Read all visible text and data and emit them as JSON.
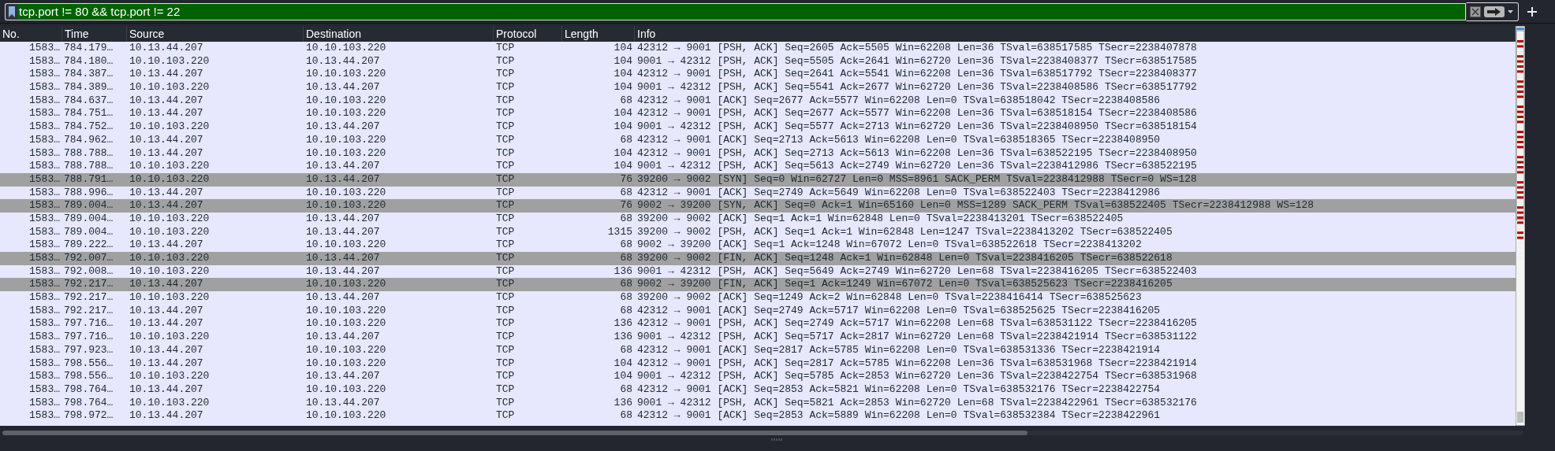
{
  "filter": {
    "value": "tcp.port != 80 && tcp.port != 22"
  },
  "columns": [
    "No.",
    "Time",
    "Source",
    "Destination",
    "Protocol",
    "Length",
    "Info"
  ],
  "rows": [
    {
      "no": "1583…",
      "time": "784.179…",
      "source": "10.13.44.207",
      "destination": "10.10.103.220",
      "protocol": "TCP",
      "length": "104",
      "info": "42312 → 9001 [PSH, ACK] Seq=2605 Ack=5505 Win=62208 Len=36 TSval=638517585 TSecr=2238407878",
      "color": "#e7e7fd"
    },
    {
      "no": "1583…",
      "time": "784.180…",
      "source": "10.10.103.220",
      "destination": "10.13.44.207",
      "protocol": "TCP",
      "length": "104",
      "info": "9001 → 42312 [PSH, ACK] Seq=5505 Ack=2641 Win=62720 Len=36 TSval=2238408377 TSecr=638517585",
      "color": "#e7e7fd"
    },
    {
      "no": "1583…",
      "time": "784.387…",
      "source": "10.13.44.207",
      "destination": "10.10.103.220",
      "protocol": "TCP",
      "length": "104",
      "info": "42312 → 9001 [PSH, ACK] Seq=2641 Ack=5541 Win=62208 Len=36 TSval=638517792 TSecr=2238408377",
      "color": "#e7e7fd"
    },
    {
      "no": "1583…",
      "time": "784.389…",
      "source": "10.10.103.220",
      "destination": "10.13.44.207",
      "protocol": "TCP",
      "length": "104",
      "info": "9001 → 42312 [PSH, ACK] Seq=5541 Ack=2677 Win=62720 Len=36 TSval=2238408586 TSecr=638517792",
      "color": "#e7e7fd"
    },
    {
      "no": "1583…",
      "time": "784.637…",
      "source": "10.13.44.207",
      "destination": "10.10.103.220",
      "protocol": "TCP",
      "length": "68",
      "info": "42312 → 9001 [ACK] Seq=2677 Ack=5577 Win=62208 Len=0 TSval=638518042 TSecr=2238408586",
      "color": "#e7e7fd"
    },
    {
      "no": "1583…",
      "time": "784.751…",
      "source": "10.13.44.207",
      "destination": "10.10.103.220",
      "protocol": "TCP",
      "length": "104",
      "info": "42312 → 9001 [PSH, ACK] Seq=2677 Ack=5577 Win=62208 Len=36 TSval=638518154 TSecr=2238408586",
      "color": "#e7e7fd"
    },
    {
      "no": "1583…",
      "time": "784.752…",
      "source": "10.10.103.220",
      "destination": "10.13.44.207",
      "protocol": "TCP",
      "length": "104",
      "info": "9001 → 42312 [PSH, ACK] Seq=5577 Ack=2713 Win=62720 Len=36 TSval=2238408950 TSecr=638518154",
      "color": "#e7e7fd"
    },
    {
      "no": "1583…",
      "time": "784.962…",
      "source": "10.13.44.207",
      "destination": "10.10.103.220",
      "protocol": "TCP",
      "length": "68",
      "info": "42312 → 9001 [ACK] Seq=2713 Ack=5613 Win=62208 Len=0 TSval=638518365 TSecr=2238408950",
      "color": "#e7e7fd"
    },
    {
      "no": "1583…",
      "time": "788.788…",
      "source": "10.13.44.207",
      "destination": "10.10.103.220",
      "protocol": "TCP",
      "length": "104",
      "info": "42312 → 9001 [PSH, ACK] Seq=2713 Ack=5613 Win=62208 Len=36 TSval=638522195 TSecr=2238408950",
      "color": "#e7e7fd"
    },
    {
      "no": "1583…",
      "time": "788.788…",
      "source": "10.10.103.220",
      "destination": "10.13.44.207",
      "protocol": "TCP",
      "length": "104",
      "info": "9001 → 42312 [PSH, ACK] Seq=5613 Ack=2749 Win=62720 Len=36 TSval=2238412986 TSecr=638522195",
      "color": "#e7e7fd"
    },
    {
      "no": "1583…",
      "time": "788.791…",
      "source": "10.10.103.220",
      "destination": "10.13.44.207",
      "protocol": "TCP",
      "length": "76",
      "info": "39200 → 9002 [SYN] Seq=0 Win=62727 Len=0 MSS=8961 SACK_PERM TSval=2238412988 TSecr=0 WS=128",
      "color": "#a0a0a0"
    },
    {
      "no": "1583…",
      "time": "788.996…",
      "source": "10.13.44.207",
      "destination": "10.10.103.220",
      "protocol": "TCP",
      "length": "68",
      "info": "42312 → 9001 [ACK] Seq=2749 Ack=5649 Win=62208 Len=0 TSval=638522403 TSecr=2238412986",
      "color": "#e7e7fd"
    },
    {
      "no": "1583…",
      "time": "789.004…",
      "source": "10.13.44.207",
      "destination": "10.10.103.220",
      "protocol": "TCP",
      "length": "76",
      "info": "9002 → 39200 [SYN, ACK] Seq=0 Ack=1 Win=65160 Len=0 MSS=1289 SACK_PERM TSval=638522405 TSecr=2238412988 WS=128",
      "color": "#a0a0a0"
    },
    {
      "no": "1583…",
      "time": "789.004…",
      "source": "10.10.103.220",
      "destination": "10.13.44.207",
      "protocol": "TCP",
      "length": "68",
      "info": "39200 → 9002 [ACK] Seq=1 Ack=1 Win=62848 Len=0 TSval=2238413201 TSecr=638522405",
      "color": "#e7e7fd"
    },
    {
      "no": "1583…",
      "time": "789.004…",
      "source": "10.10.103.220",
      "destination": "10.13.44.207",
      "protocol": "TCP",
      "length": "1315",
      "info": "39200 → 9002 [PSH, ACK] Seq=1 Ack=1 Win=62848 Len=1247 TSval=2238413202 TSecr=638522405",
      "color": "#e7e7fd"
    },
    {
      "no": "1583…",
      "time": "789.222…",
      "source": "10.13.44.207",
      "destination": "10.10.103.220",
      "protocol": "TCP",
      "length": "68",
      "info": "9002 → 39200 [ACK] Seq=1 Ack=1248 Win=67072 Len=0 TSval=638522618 TSecr=2238413202",
      "color": "#e7e7fd"
    },
    {
      "no": "1583…",
      "time": "792.007…",
      "source": "10.10.103.220",
      "destination": "10.13.44.207",
      "protocol": "TCP",
      "length": "68",
      "info": "39200 → 9002 [FIN, ACK] Seq=1248 Ack=1 Win=62848 Len=0 TSval=2238416205 TSecr=638522618",
      "color": "#a0a0a0"
    },
    {
      "no": "1583…",
      "time": "792.008…",
      "source": "10.10.103.220",
      "destination": "10.13.44.207",
      "protocol": "TCP",
      "length": "136",
      "info": "9001 → 42312 [PSH, ACK] Seq=5649 Ack=2749 Win=62720 Len=68 TSval=2238416205 TSecr=638522403",
      "color": "#e7e7fd"
    },
    {
      "no": "1583…",
      "time": "792.217…",
      "source": "10.13.44.207",
      "destination": "10.10.103.220",
      "protocol": "TCP",
      "length": "68",
      "info": "9002 → 39200 [FIN, ACK] Seq=1 Ack=1249 Win=67072 Len=0 TSval=638525623 TSecr=2238416205",
      "color": "#a0a0a0"
    },
    {
      "no": "1583…",
      "time": "792.217…",
      "source": "10.10.103.220",
      "destination": "10.13.44.207",
      "protocol": "TCP",
      "length": "68",
      "info": "39200 → 9002 [ACK] Seq=1249 Ack=2 Win=62848 Len=0 TSval=2238416414 TSecr=638525623",
      "color": "#e7e7fd"
    },
    {
      "no": "1583…",
      "time": "792.217…",
      "source": "10.13.44.207",
      "destination": "10.10.103.220",
      "protocol": "TCP",
      "length": "68",
      "info": "42312 → 9001 [ACK] Seq=2749 Ack=5717 Win=62208 Len=0 TSval=638525625 TSecr=2238416205",
      "color": "#e7e7fd"
    },
    {
      "no": "1583…",
      "time": "797.716…",
      "source": "10.13.44.207",
      "destination": "10.10.103.220",
      "protocol": "TCP",
      "length": "136",
      "info": "42312 → 9001 [PSH, ACK] Seq=2749 Ack=5717 Win=62208 Len=68 TSval=638531122 TSecr=2238416205",
      "color": "#e7e7fd"
    },
    {
      "no": "1583…",
      "time": "797.716…",
      "source": "10.10.103.220",
      "destination": "10.13.44.207",
      "protocol": "TCP",
      "length": "136",
      "info": "9001 → 42312 [PSH, ACK] Seq=5717 Ack=2817 Win=62720 Len=68 TSval=2238421914 TSecr=638531122",
      "color": "#e7e7fd"
    },
    {
      "no": "1583…",
      "time": "797.923…",
      "source": "10.13.44.207",
      "destination": "10.10.103.220",
      "protocol": "TCP",
      "length": "68",
      "info": "42312 → 9001 [ACK] Seq=2817 Ack=5785 Win=62208 Len=0 TSval=638531336 TSecr=2238421914",
      "color": "#e7e7fd"
    },
    {
      "no": "1583…",
      "time": "798.556…",
      "source": "10.13.44.207",
      "destination": "10.10.103.220",
      "protocol": "TCP",
      "length": "104",
      "info": "42312 → 9001 [PSH, ACK] Seq=2817 Ack=5785 Win=62208 Len=36 TSval=638531968 TSecr=2238421914",
      "color": "#e7e7fd"
    },
    {
      "no": "1583…",
      "time": "798.556…",
      "source": "10.10.103.220",
      "destination": "10.13.44.207",
      "protocol": "TCP",
      "length": "104",
      "info": "9001 → 42312 [PSH, ACK] Seq=5785 Ack=2853 Win=62720 Len=36 TSval=2238422754 TSecr=638531968",
      "color": "#e7e7fd"
    },
    {
      "no": "1583…",
      "time": "798.764…",
      "source": "10.13.44.207",
      "destination": "10.10.103.220",
      "protocol": "TCP",
      "length": "68",
      "info": "42312 → 9001 [ACK] Seq=2853 Ack=5821 Win=62208 Len=0 TSval=638532176 TSecr=2238422754",
      "color": "#e7e7fd"
    },
    {
      "no": "1583…",
      "time": "798.764…",
      "source": "10.10.103.220",
      "destination": "10.13.44.207",
      "protocol": "TCP",
      "length": "136",
      "info": "9001 → 42312 [PSH, ACK] Seq=5821 Ack=2853 Win=62720 Len=68 TSval=2238422961 TSecr=638532176",
      "color": "#e7e7fd"
    },
    {
      "no": "1583…",
      "time": "798.972…",
      "source": "10.13.44.207",
      "destination": "10.10.103.220",
      "protocol": "TCP",
      "length": "68",
      "info": "42312 → 9001 [ACK] Seq=2853 Ack=5889 Win=62208 Len=0 TSval=638532384 TSecr=2238422961",
      "color": "#e7e7fd"
    }
  ]
}
